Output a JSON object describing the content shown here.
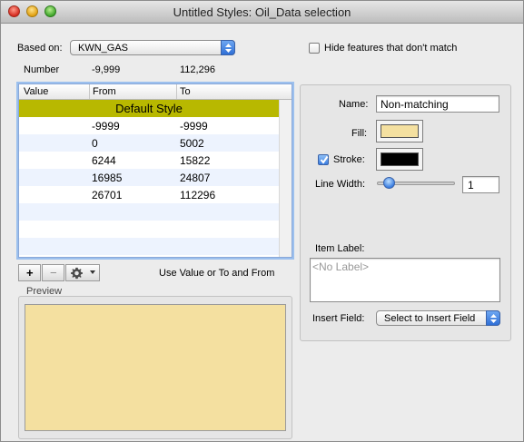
{
  "window": {
    "title": "Untitled Styles: Oil_Data selection"
  },
  "based_on": {
    "label": "Based on:",
    "value": "KWN_GAS"
  },
  "hide_features": {
    "label": "Hide features that don't match",
    "checked": false
  },
  "range": {
    "field": "Number",
    "min": "-9,999",
    "max": "112,296"
  },
  "table": {
    "headers": [
      "Value",
      "From",
      "To"
    ],
    "default_row": "Default Style",
    "rows": [
      {
        "from": "-9999",
        "to": "-9999"
      },
      {
        "from": "0",
        "to": "5002"
      },
      {
        "from": "6244",
        "to": "15822"
      },
      {
        "from": "16985",
        "to": "24807"
      },
      {
        "from": "26701",
        "to": "112296"
      }
    ]
  },
  "toolbar": {
    "add": "+",
    "remove": "−",
    "hint": "Use Value or To and From"
  },
  "preview": {
    "label": "Preview",
    "color": "#f4e0a0"
  },
  "style": {
    "name_label": "Name:",
    "name_value": "Non-matching",
    "fill_label": "Fill:",
    "fill_color": "#f4e0a0",
    "stroke_label": "Stroke:",
    "stroke_checked": true,
    "stroke_color": "#000000",
    "line_width_label": "Line Width:",
    "line_width_value": "1",
    "item_label_label": "Item Label:",
    "item_label_placeholder": "<No Label>",
    "insert_field_label": "Insert Field:",
    "insert_field_value": "Select to Insert Field"
  }
}
